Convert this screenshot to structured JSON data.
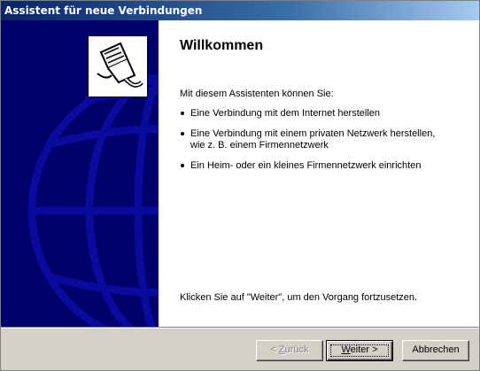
{
  "window": {
    "title": "Assistent für neue Verbindungen"
  },
  "side_panel": {
    "icon": "network-cable-plug-icon",
    "background": "globe-graphic"
  },
  "main": {
    "heading": "Willkommen",
    "intro": "Mit diesem Assistenten können Sie:",
    "bullets": [
      "Eine Verbindung mit dem Internet herstellen",
      "Eine Verbindung mit einem privaten Netzwerk herstellen,",
      "wie z. B. einem Firmennetzwerk",
      "Ein Heim- oder ein kleines Firmennetzwerk einrichten"
    ],
    "footer": "Klicken Sie auf \"Weiter\", um den Vorgang fortzusetzen."
  },
  "buttons": {
    "back": {
      "prefix": "< ",
      "hotkey": "Z",
      "rest": "urück",
      "enabled": false
    },
    "next": {
      "hotkey": "W",
      "rest": "eiter >",
      "enabled": true
    },
    "cancel": {
      "label": "Abbrechen",
      "enabled": true
    }
  },
  "colors": {
    "title_bar": "#0a246a",
    "side_panel": "#00006a",
    "dialog_face": "#d4d0c8"
  }
}
